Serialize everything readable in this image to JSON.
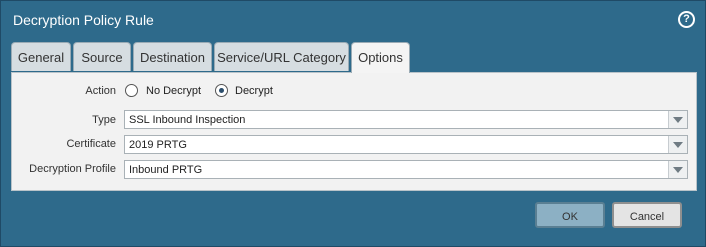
{
  "dialog": {
    "title": "Decryption Policy Rule",
    "help_icon": "help-icon"
  },
  "tabs": [
    {
      "label": "General"
    },
    {
      "label": "Source"
    },
    {
      "label": "Destination"
    },
    {
      "label": "Service/URL Category"
    },
    {
      "label": "Options",
      "active": true
    }
  ],
  "form": {
    "action": {
      "label": "Action",
      "options": [
        {
          "label": "No Decrypt",
          "checked": false
        },
        {
          "label": "Decrypt",
          "checked": true
        }
      ]
    },
    "type": {
      "label": "Type",
      "value": "SSL Inbound Inspection"
    },
    "certificate": {
      "label": "Certificate",
      "value": "2019 PRTG"
    },
    "decryption_profile": {
      "label": "Decryption Profile",
      "value": "Inbound PRTG"
    }
  },
  "buttons": {
    "ok": "OK",
    "cancel": "Cancel"
  },
  "colors": {
    "frame": "#2e6a8b",
    "panel": "#f2f2f2",
    "ok_button": "#8cb0c4"
  }
}
